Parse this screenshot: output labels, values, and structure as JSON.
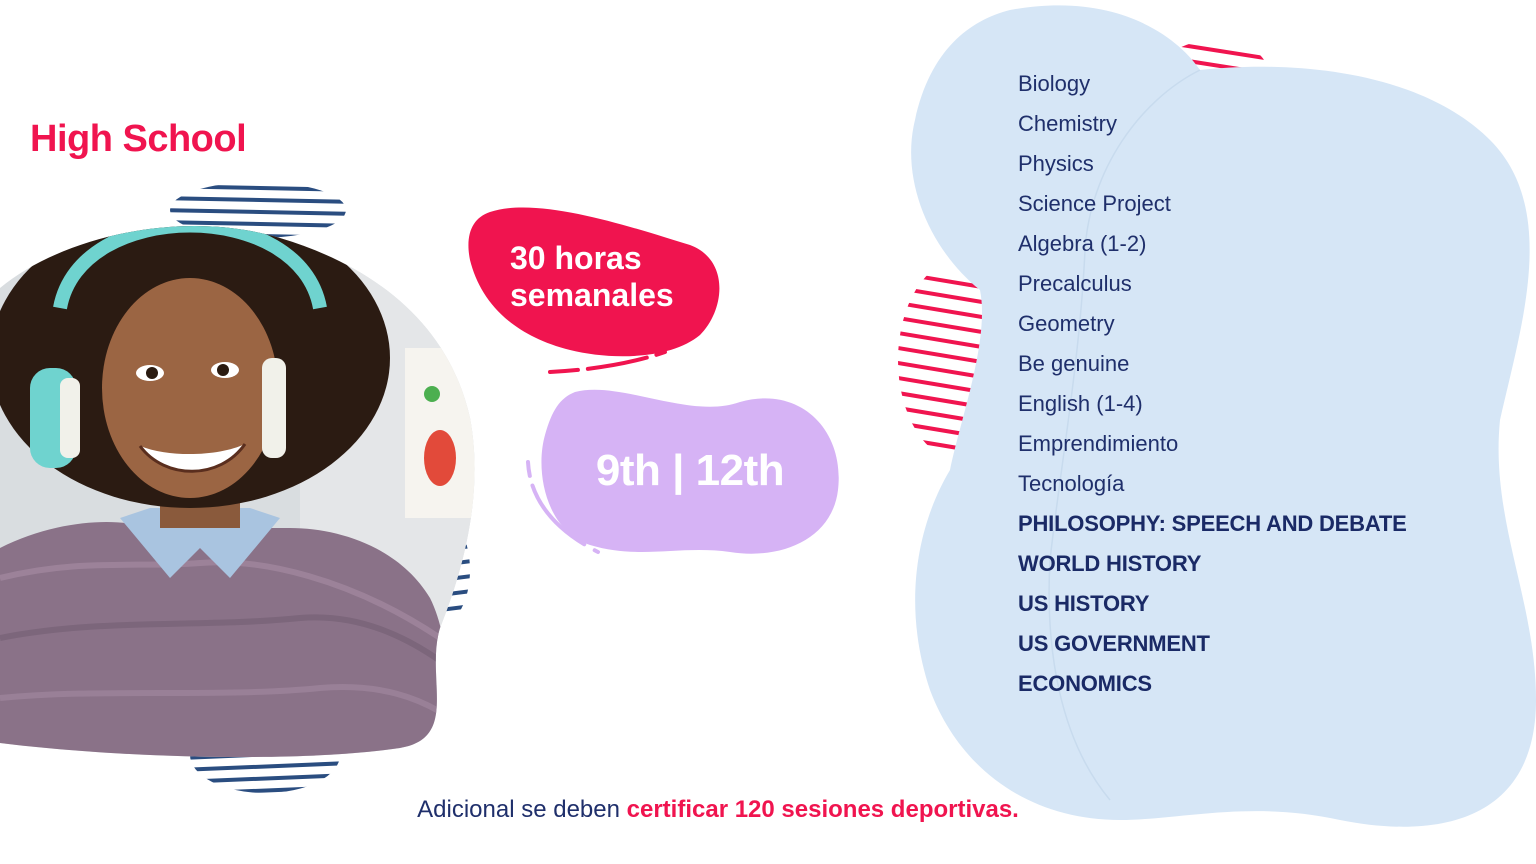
{
  "header": {
    "title": "High School"
  },
  "badges": {
    "hours_line1": "30 horas",
    "hours_line2": "semanales",
    "grades": "9th | 12th"
  },
  "subjects": {
    "regular": [
      "Biology",
      "Chemistry",
      "Physics",
      "Science Project",
      "Algebra (1-2)",
      "Precalculus",
      "Geometry",
      "Be genuine",
      "English (1-4)",
      "Emprendimiento",
      "Tecnología"
    ],
    "emphasized": [
      "PHILOSOPHY: SPEECH AND DEBATE",
      "WORLD HISTORY",
      "US HISTORY",
      "US GOVERNMENT",
      "ECONOMICS"
    ]
  },
  "footer": {
    "prefix": "Adicional se deben ",
    "highlight": "certificar 120 sesiones deportivas."
  },
  "colors": {
    "accent_pink": "#f0144f",
    "lavender": "#d6b3f5",
    "light_blue": "#d6e6f6",
    "navy": "#1f2f6b",
    "stripe_blue": "#2a4d80"
  },
  "image": {
    "alt": "smiling-student-with-headphones-photo"
  }
}
